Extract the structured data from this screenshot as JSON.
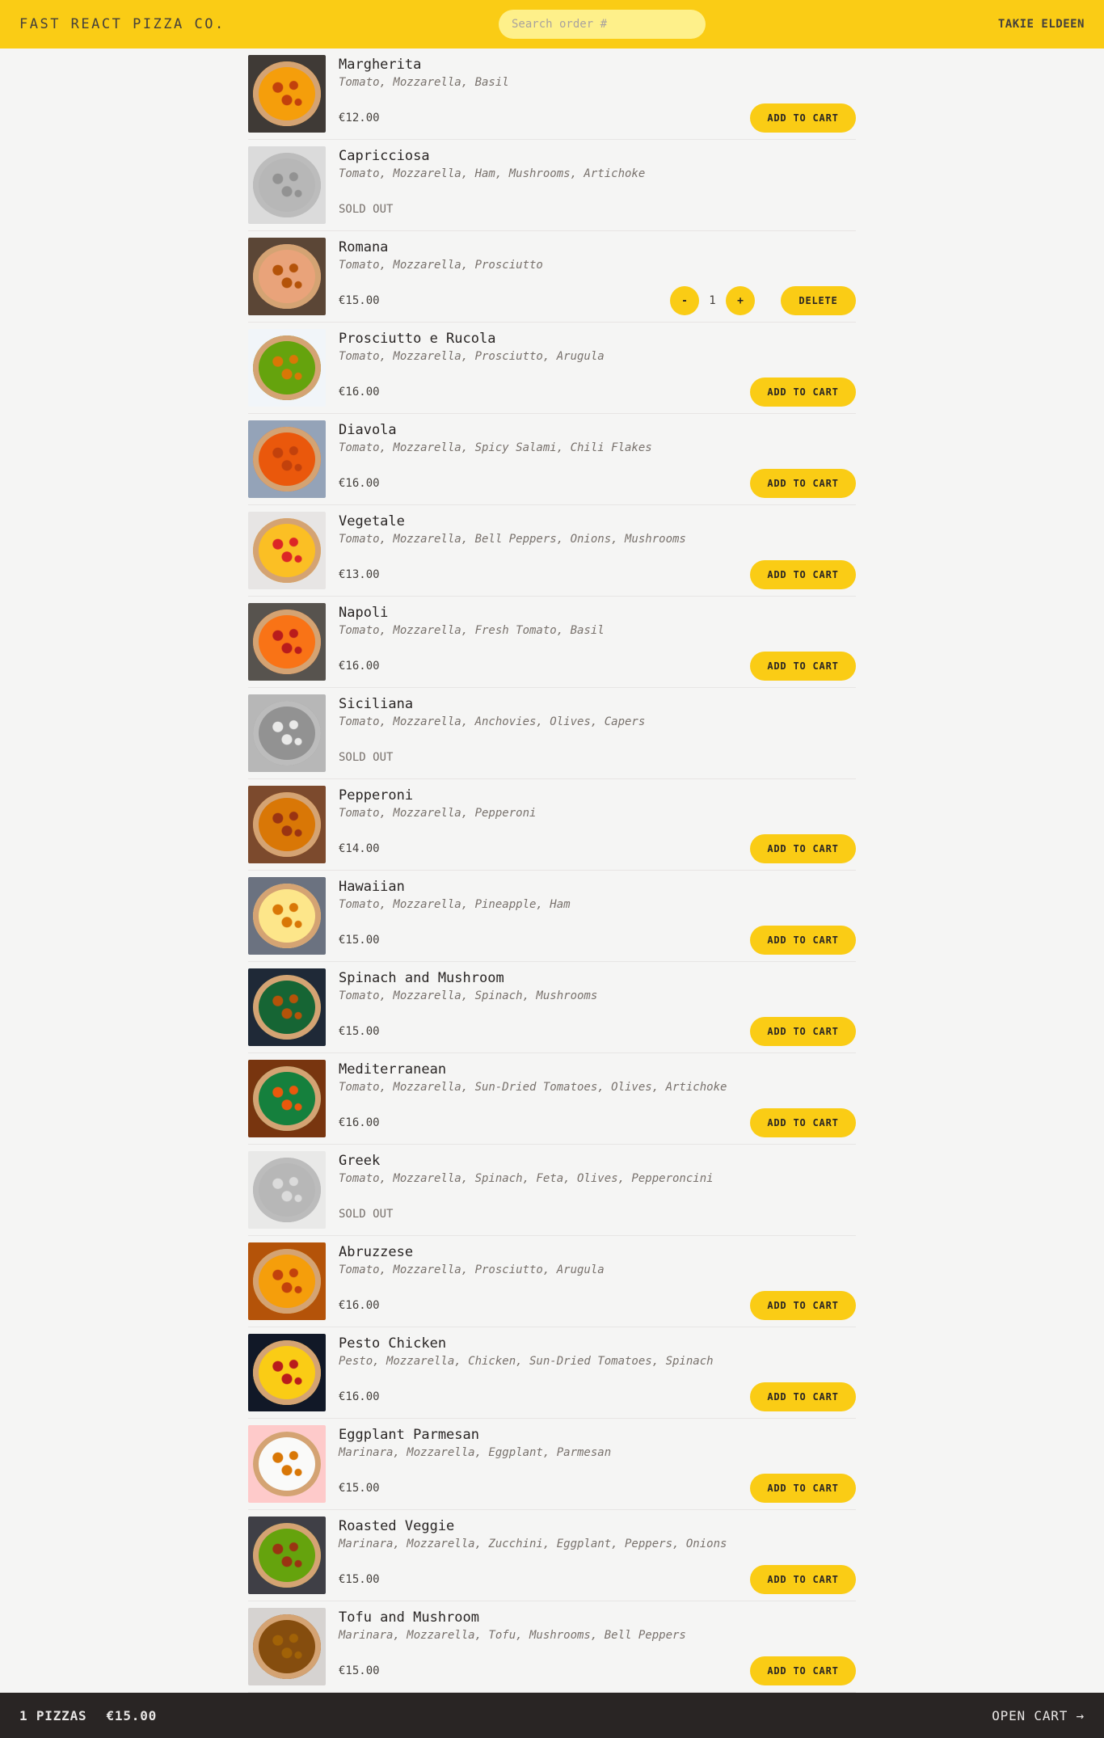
{
  "header": {
    "logo": "Fast React Pizza Co.",
    "search_placeholder": "Search order #",
    "username": "Takie Eldeen"
  },
  "colors": {
    "accent": "#facc15",
    "background": "#f5f5f4",
    "cartbar": "#292524"
  },
  "labels": {
    "add_to_cart": "Add to cart",
    "sold_out": "Sold out",
    "delete": "Delete",
    "decrease": "-",
    "increase": "+"
  },
  "menu": [
    {
      "name": "Margherita",
      "ingredients": "Tomato, Mozzarella, Basil",
      "price": "€12.00",
      "sold_out": false,
      "in_cart": 0,
      "image": "margherita-photo"
    },
    {
      "name": "Capricciosa",
      "ingredients": "Tomato, Mozzarella, Ham, Mushrooms, Artichoke",
      "price": "",
      "sold_out": true,
      "in_cart": 0,
      "image": "capricciosa-photo"
    },
    {
      "name": "Romana",
      "ingredients": "Tomato, Mozzarella, Prosciutto",
      "price": "€15.00",
      "sold_out": false,
      "in_cart": 1,
      "image": "romana-photo"
    },
    {
      "name": "Prosciutto e Rucola",
      "ingredients": "Tomato, Mozzarella, Prosciutto, Arugula",
      "price": "€16.00",
      "sold_out": false,
      "in_cart": 0,
      "image": "prosciutto-rucola-photo"
    },
    {
      "name": "Diavola",
      "ingredients": "Tomato, Mozzarella, Spicy Salami, Chili Flakes",
      "price": "€16.00",
      "sold_out": false,
      "in_cart": 0,
      "image": "diavola-photo"
    },
    {
      "name": "Vegetale",
      "ingredients": "Tomato, Mozzarella, Bell Peppers, Onions, Mushrooms",
      "price": "€13.00",
      "sold_out": false,
      "in_cart": 0,
      "image": "vegetale-photo"
    },
    {
      "name": "Napoli",
      "ingredients": "Tomato, Mozzarella, Fresh Tomato, Basil",
      "price": "€16.00",
      "sold_out": false,
      "in_cart": 0,
      "image": "napoli-photo"
    },
    {
      "name": "Siciliana",
      "ingredients": "Tomato, Mozzarella, Anchovies, Olives, Capers",
      "price": "",
      "sold_out": true,
      "in_cart": 0,
      "image": "siciliana-photo"
    },
    {
      "name": "Pepperoni",
      "ingredients": "Tomato, Mozzarella, Pepperoni",
      "price": "€14.00",
      "sold_out": false,
      "in_cart": 0,
      "image": "pepperoni-photo"
    },
    {
      "name": "Hawaiian",
      "ingredients": "Tomato, Mozzarella, Pineapple, Ham",
      "price": "€15.00",
      "sold_out": false,
      "in_cart": 0,
      "image": "hawaiian-photo"
    },
    {
      "name": "Spinach and Mushroom",
      "ingredients": "Tomato, Mozzarella, Spinach, Mushrooms",
      "price": "€15.00",
      "sold_out": false,
      "in_cart": 0,
      "image": "spinach-mushroom-photo"
    },
    {
      "name": "Mediterranean",
      "ingredients": "Tomato, Mozzarella, Sun-Dried Tomatoes, Olives, Artichoke",
      "price": "€16.00",
      "sold_out": false,
      "in_cart": 0,
      "image": "mediterranean-photo"
    },
    {
      "name": "Greek",
      "ingredients": "Tomato, Mozzarella, Spinach, Feta, Olives, Pepperoncini",
      "price": "",
      "sold_out": true,
      "in_cart": 0,
      "image": "greek-photo"
    },
    {
      "name": "Abruzzese",
      "ingredients": "Tomato, Mozzarella, Prosciutto, Arugula",
      "price": "€16.00",
      "sold_out": false,
      "in_cart": 0,
      "image": "abruzzese-photo"
    },
    {
      "name": "Pesto Chicken",
      "ingredients": "Pesto, Mozzarella, Chicken, Sun-Dried Tomatoes, Spinach",
      "price": "€16.00",
      "sold_out": false,
      "in_cart": 0,
      "image": "pesto-chicken-photo"
    },
    {
      "name": "Eggplant Parmesan",
      "ingredients": "Marinara, Mozzarella, Eggplant, Parmesan",
      "price": "€15.00",
      "sold_out": false,
      "in_cart": 0,
      "image": "eggplant-parmesan-photo"
    },
    {
      "name": "Roasted Veggie",
      "ingredients": "Marinara, Mozzarella, Zucchini, Eggplant, Peppers, Onions",
      "price": "€15.00",
      "sold_out": false,
      "in_cart": 0,
      "image": "roasted-veggie-photo"
    },
    {
      "name": "Tofu and Mushroom",
      "ingredients": "Marinara, Mozzarella, Tofu, Mushrooms, Bell Peppers",
      "price": "€15.00",
      "sold_out": false,
      "in_cart": 0,
      "image": "tofu-mushroom-photo"
    }
  ],
  "cart": {
    "count_label": "1 pizzas",
    "total": "€15.00",
    "open_label": "Open cart →"
  }
}
